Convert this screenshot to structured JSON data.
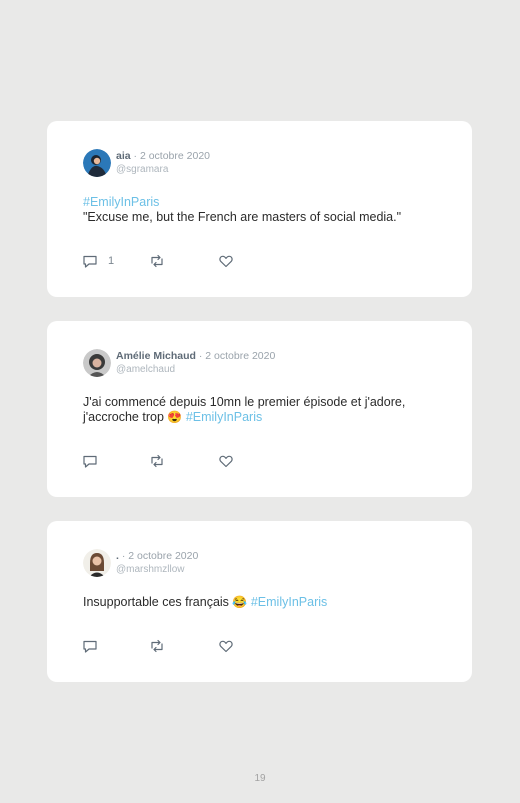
{
  "tweets": [
    {
      "username": "aia",
      "date": "· 2 octobre 2020",
      "handle": "@sgramara",
      "hashtag": "#EmilyInParis",
      "text": "\"Excuse me, but the French are masters of social media.\"",
      "reply_count": "1"
    },
    {
      "username": "Amélie Michaud",
      "date": "· 2 octobre 2020",
      "handle": "@amelchaud",
      "text_line1": "J'ai commencé depuis 10mn le premier épisode et j'adore,",
      "text_line2": "j'accroche trop",
      "emoji": "😍",
      "hashtag": "#EmilyInParis"
    },
    {
      "username": ".",
      "date": "· 2 octobre 2020",
      "handle": "@marshmzllow",
      "text": "Insupportable ces français",
      "emoji": "😂",
      "hashtag": "#EmilyInParis"
    }
  ],
  "icons": [
    "reply-icon",
    "retweet-icon",
    "like-icon"
  ],
  "colors": {
    "hashtag": "#6cc0e6",
    "background": "#e9e9e8",
    "card": "#ffffff"
  },
  "page": {
    "number": "19"
  }
}
